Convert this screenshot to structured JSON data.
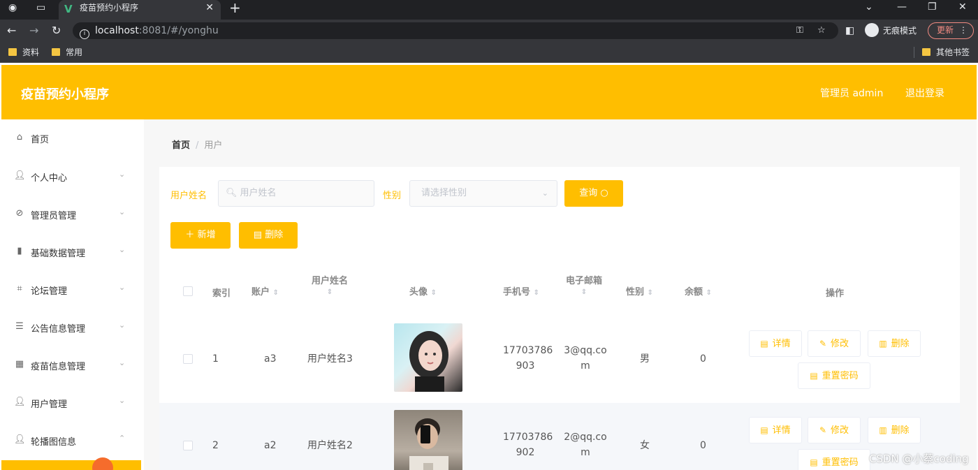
{
  "browser": {
    "tab_title": "疫苗预约小程序",
    "url_host": "localhost",
    "url_rest": ":8081/#/yonghu",
    "incognito_label": "无痕模式",
    "update_label": "更新",
    "bookmarks": [
      "资料",
      "常用"
    ],
    "other_bookmarks": "其他书签"
  },
  "header": {
    "title": "疫苗预约小程序",
    "admin_label": "管理员 admin",
    "logout_label": "退出登录",
    "accent_color": "#ffbe00"
  },
  "sidebar": {
    "items": [
      {
        "label": "首页",
        "icon": "home-icon"
      },
      {
        "label": "个人中心",
        "icon": "user-icon"
      },
      {
        "label": "管理员管理",
        "icon": "admin-icon"
      },
      {
        "label": "基础数据管理",
        "icon": "bar-chart-icon"
      },
      {
        "label": "论坛管理",
        "icon": "crop-icon"
      },
      {
        "label": "公告信息管理",
        "icon": "list-icon"
      },
      {
        "label": "疫苗信息管理",
        "icon": "grid-icon"
      },
      {
        "label": "用户管理",
        "icon": "user-manage-icon"
      },
      {
        "label": "轮播图信息",
        "icon": "carousel-icon"
      }
    ]
  },
  "breadcrumb": {
    "home": "首页",
    "separator": "/",
    "current": "用户"
  },
  "search": {
    "name_label": "用户姓名",
    "name_placeholder": "用户姓名",
    "gender_label": "性别",
    "gender_placeholder": "请选择性别",
    "query_button": "查询"
  },
  "actions": {
    "add_button": "新增",
    "delete_button": "删除"
  },
  "table": {
    "columns": {
      "index": "索引",
      "account": "账户",
      "name": "用户姓名",
      "avatar": "头像",
      "phone": "手机号",
      "email": "电子邮箱",
      "gender": "性别",
      "balance": "余额",
      "operations": "操作"
    },
    "rows": [
      {
        "index": "1",
        "account": "a3",
        "name": "用户姓名3",
        "phone_line1": "17703786",
        "phone_line2": "903",
        "email_line1": "3@qq.co",
        "email_line2": "m",
        "gender": "男",
        "balance": "0"
      },
      {
        "index": "2",
        "account": "a2",
        "name": "用户姓名2",
        "phone_line1": "17703786",
        "phone_line2": "902",
        "email_line1": "2@qq.co",
        "email_line2": "m",
        "gender": "女",
        "balance": "0"
      }
    ],
    "row_buttons": {
      "detail": "详情",
      "edit": "修改",
      "delete": "删除",
      "reset_password": "重置密码"
    }
  },
  "watermark": "CSDN @小蔡coding"
}
